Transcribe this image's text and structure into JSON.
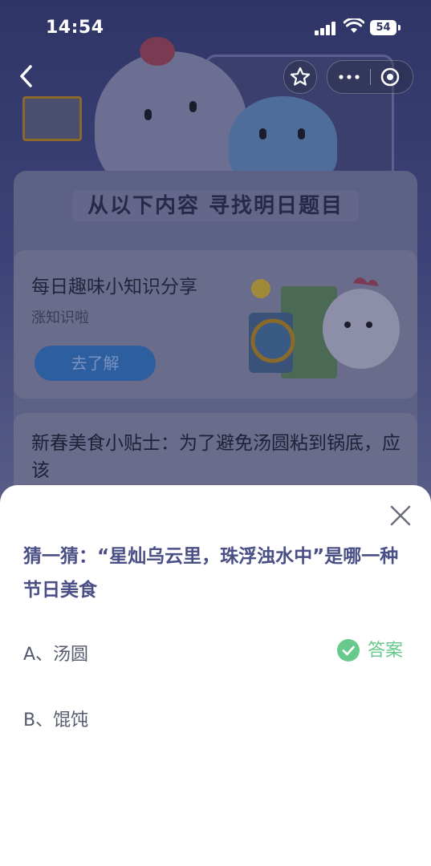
{
  "status_bar": {
    "time": "14:54",
    "battery": "54"
  },
  "panel": {
    "title": "从以下内容 寻找明日题目"
  },
  "card1": {
    "title": "每日趣味小知识分享",
    "subtitle": "涨知识啦",
    "button_label": "去了解"
  },
  "card2": {
    "title": "新春美食小贴士：为了避免汤圆粘到锅底，应该"
  },
  "sheet": {
    "question": "猜一猜：“星灿乌云里，珠浮浊水中”是哪一种节日美食",
    "options": [
      {
        "label": "A、汤圆",
        "is_answer": true
      },
      {
        "label": "B、馄饨",
        "is_answer": false
      }
    ],
    "answer_label": "答案"
  },
  "colors": {
    "accent_green": "#67c98c",
    "question_text": "#4a4f85",
    "button_blue": "#2d5ea0"
  }
}
